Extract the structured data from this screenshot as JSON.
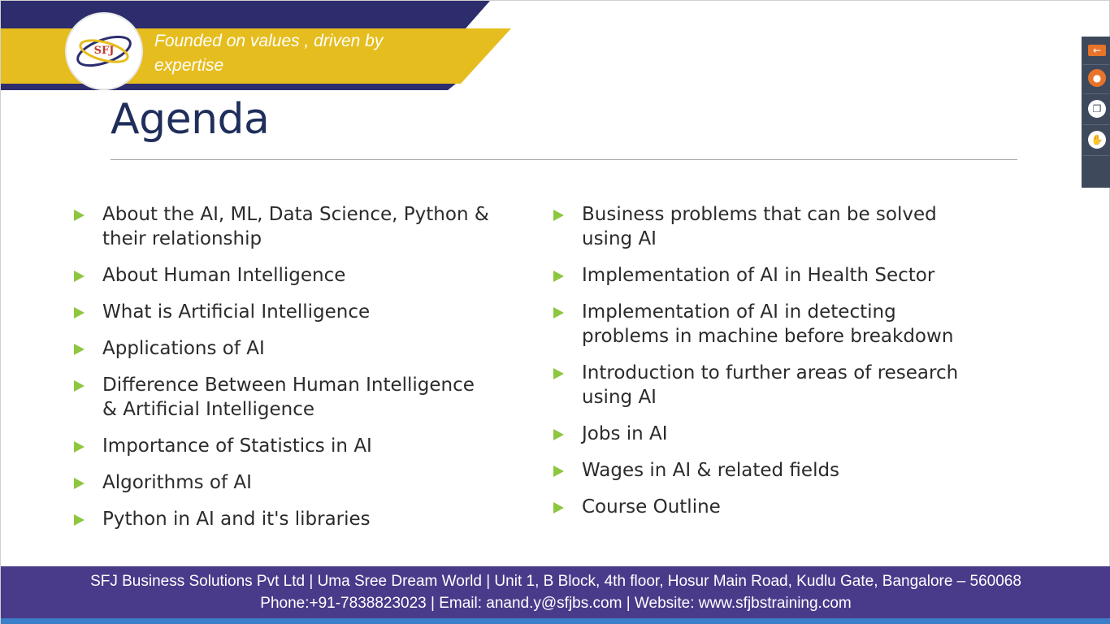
{
  "colors": {
    "banner_yellow": "#e6bd1e",
    "banner_navy": "#2d2d6e",
    "title": "#1f2e5a",
    "bullet": "#8dc63f",
    "footer": "#4a3a8a",
    "footer_strip": "#3a7fc8"
  },
  "header": {
    "logo_text": "SFJ",
    "tagline": "Founded on values , driven by expertise"
  },
  "title": "Agenda",
  "agenda": {
    "left": [
      "About the AI, ML, Data Science, Python & their relationship",
      "About Human Intelligence",
      "What is Artificial Intelligence",
      "Applications of AI",
      "Difference Between Human Intelligence & Artificial Intelligence",
      "Importance of Statistics in AI",
      "Algorithms of AI",
      "Python in AI and it's libraries"
    ],
    "right": [
      "Business problems that can be solved using AI",
      "Implementation of AI in Health Sector",
      "Implementation of AI in detecting problems in machine before breakdown",
      "Introduction to further areas of research using AI",
      "Jobs in AI",
      "Wages in AI & related fields",
      "Course Outline"
    ]
  },
  "toolbar": {
    "icons": [
      "arrow-left-icon",
      "microphone-off-icon",
      "window-icon",
      "hand-icon"
    ]
  },
  "footer": {
    "line1": "SFJ Business Solutions Pvt Ltd | Uma Sree Dream World | Unit 1, B Block, 4th floor, Hosur Main Road, Kudlu Gate, Bangalore – 560068",
    "line2": "Phone:+91-7838823023 | Email: anand.y@sfjbs.com | Website: www.sfjbstraining.com"
  }
}
